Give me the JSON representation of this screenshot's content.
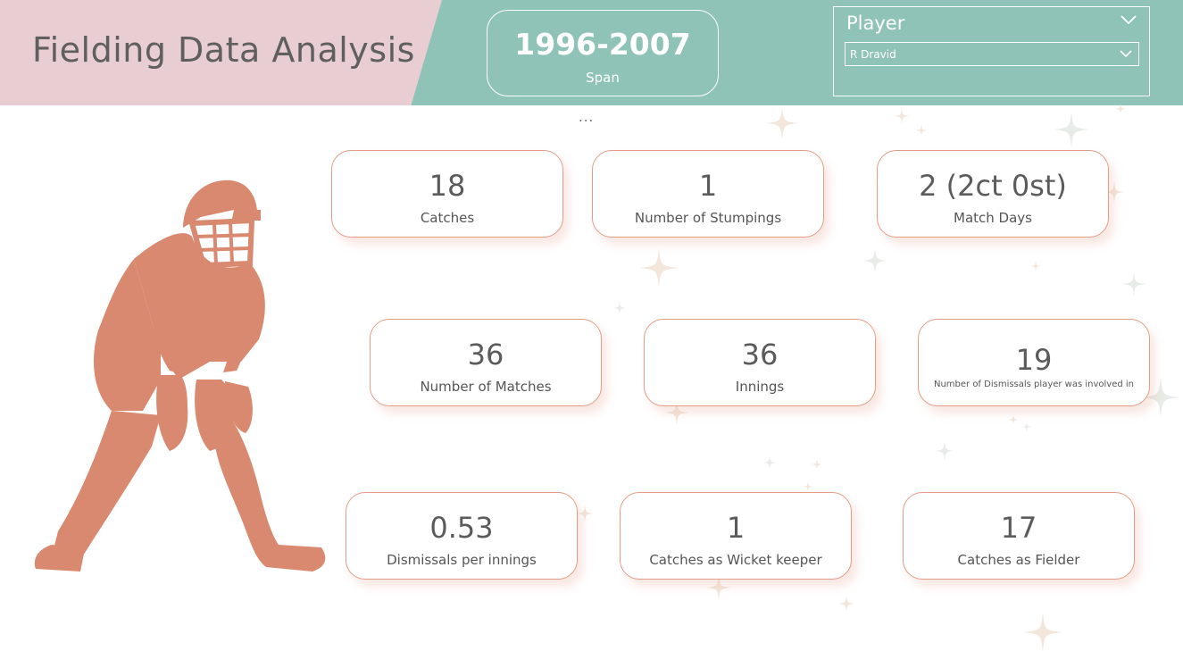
{
  "header": {
    "title": "Fielding Data Analysis",
    "span": {
      "value": "1996-2007",
      "label": "Span"
    },
    "slicer": {
      "title": "Player",
      "selected": "R Dravid"
    },
    "more_options": "..."
  },
  "cards": [
    {
      "value": "18",
      "label": "Catches"
    },
    {
      "value": "1",
      "label": "Number of Stumpings"
    },
    {
      "value": "2 (2ct 0st)",
      "label": "Match Days"
    },
    {
      "value": "36",
      "label": "Number of Matches"
    },
    {
      "value": "36",
      "label": "Innings"
    },
    {
      "value": "19",
      "label": "Number of Dismissals player was involved in"
    },
    {
      "value": "0.53",
      "label": "Dismissals per innings"
    },
    {
      "value": "1",
      "label": "Catches as Wicket keeper"
    },
    {
      "value": "17",
      "label": "Catches as Fielder"
    }
  ],
  "colors": {
    "header_teal": "#8fc3b7",
    "header_pink": "#e8cdd2",
    "accent_orange": "#d9896f",
    "card_border": "#e49c86"
  },
  "icons": {
    "player": "wicket-keeper-silhouette-icon"
  }
}
